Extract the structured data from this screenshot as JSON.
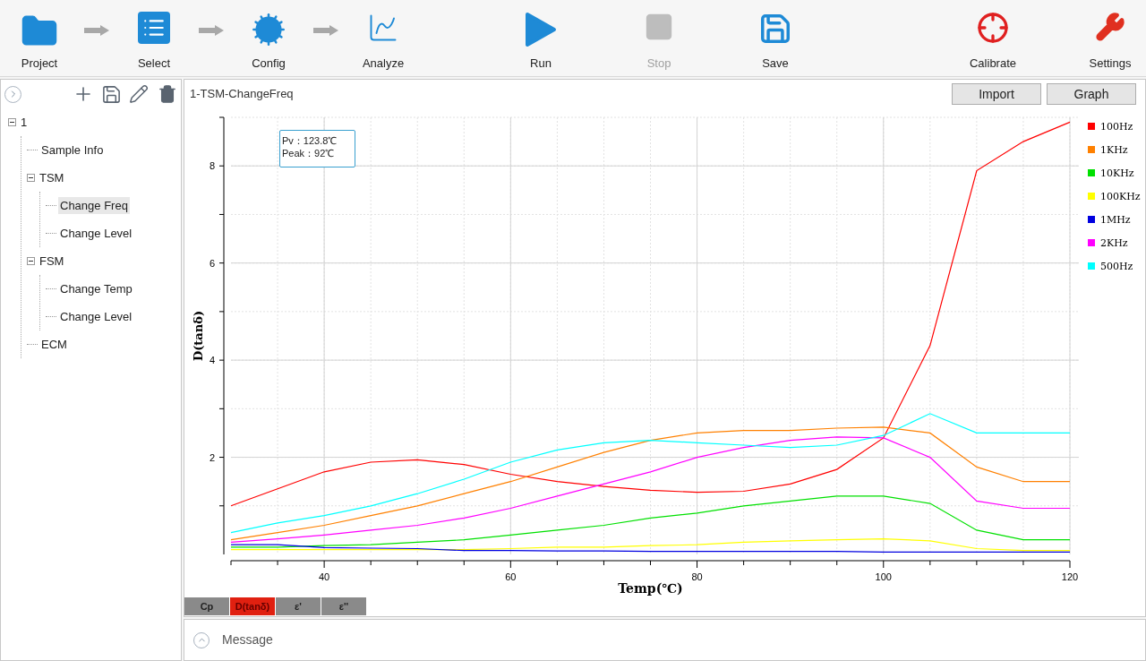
{
  "toolbar": {
    "workflow": [
      {
        "label": "Project"
      },
      {
        "label": "Select"
      },
      {
        "label": "Config"
      },
      {
        "label": "Analyze"
      }
    ],
    "actions": [
      {
        "label": "Run",
        "disabled": false
      },
      {
        "label": "Stop",
        "disabled": true
      },
      {
        "label": "Save",
        "disabled": false
      },
      {
        "label": "Calibrate",
        "disabled": false
      },
      {
        "label": "Settings",
        "disabled": false
      }
    ]
  },
  "sidebar": {
    "tree": [
      {
        "label": "1",
        "expanded": true,
        "selected": false,
        "children": [
          {
            "label": "Sample Info",
            "selected": false
          },
          {
            "label": "TSM",
            "expanded": true,
            "selected": false,
            "children": [
              {
                "label": "Change Freq",
                "selected": true
              },
              {
                "label": "Change Level",
                "selected": false
              }
            ]
          },
          {
            "label": "FSM",
            "expanded": true,
            "selected": false,
            "children": [
              {
                "label": "Change Temp",
                "selected": false
              },
              {
                "label": "Change Level",
                "selected": false
              }
            ]
          },
          {
            "label": "ECM",
            "selected": false
          }
        ]
      }
    ]
  },
  "panel": {
    "title": "1-TSM-ChangeFreq",
    "buttons": [
      "Import",
      "Graph"
    ],
    "readout": [
      "Pv：123.8℃",
      "Peak：92℃"
    ],
    "chart_data": {
      "type": "line",
      "grid": true,
      "legend": true,
      "xlabel": "Temp(℃)",
      "ylabel": "D(tanδ)",
      "x": [
        30,
        35,
        40,
        45,
        50,
        55,
        60,
        65,
        70,
        75,
        80,
        85,
        90,
        95,
        100,
        105,
        110,
        115,
        120
      ],
      "xlim": [
        30,
        120
      ],
      "ylim": [
        0,
        9
      ],
      "xticks": [
        40,
        60,
        80,
        100,
        120
      ],
      "yticks": [
        2,
        4,
        6,
        8
      ],
      "series": [
        {
          "name": "100Hz",
          "color": "#ff0000",
          "values": [
            1.0,
            1.35,
            1.7,
            1.9,
            1.95,
            1.85,
            1.65,
            1.5,
            1.4,
            1.32,
            1.28,
            1.3,
            1.45,
            1.75,
            2.4,
            4.3,
            7.9,
            8.5,
            8.9
          ]
        },
        {
          "name": "1KHz",
          "color": "#ff8000",
          "values": [
            0.3,
            0.45,
            0.6,
            0.8,
            1.0,
            1.25,
            1.5,
            1.8,
            2.1,
            2.35,
            2.5,
            2.55,
            2.55,
            2.6,
            2.62,
            2.5,
            1.8,
            1.5,
            1.5
          ]
        },
        {
          "name": "10KHz",
          "color": "#00e000",
          "values": [
            0.15,
            0.15,
            0.18,
            0.2,
            0.25,
            0.3,
            0.4,
            0.5,
            0.6,
            0.75,
            0.85,
            1.0,
            1.1,
            1.2,
            1.2,
            1.05,
            0.5,
            0.3,
            0.3
          ]
        },
        {
          "name": "100KHz",
          "color": "#ffff00",
          "values": [
            0.1,
            0.1,
            0.1,
            0.1,
            0.1,
            0.1,
            0.12,
            0.15,
            0.15,
            0.18,
            0.2,
            0.25,
            0.28,
            0.3,
            0.32,
            0.28,
            0.12,
            0.08,
            0.08
          ]
        },
        {
          "name": "1MHz",
          "color": "#0000e0",
          "values": [
            0.2,
            0.2,
            0.14,
            0.13,
            0.12,
            0.08,
            0.08,
            0.07,
            0.07,
            0.06,
            0.06,
            0.06,
            0.06,
            0.06,
            0.05,
            0.05,
            0.05,
            0.05,
            0.05
          ]
        },
        {
          "name": "2KHz",
          "color": "#ff00ff",
          "values": [
            0.25,
            0.32,
            0.4,
            0.5,
            0.6,
            0.75,
            0.95,
            1.2,
            1.45,
            1.7,
            2.0,
            2.2,
            2.35,
            2.42,
            2.4,
            2.0,
            1.1,
            0.95,
            0.95
          ]
        },
        {
          "name": "500Hz",
          "color": "#00ffff",
          "values": [
            0.45,
            0.65,
            0.8,
            1.0,
            1.25,
            1.55,
            1.9,
            2.15,
            2.3,
            2.35,
            2.3,
            2.25,
            2.2,
            2.25,
            2.45,
            2.9,
            2.5,
            2.5,
            2.5
          ]
        }
      ]
    },
    "chart_tabs": [
      {
        "label": "Cp",
        "selected": false
      },
      {
        "label": "D(tanδ)",
        "selected": true
      },
      {
        "label": "ε'",
        "selected": false
      },
      {
        "label": "ε''",
        "selected": false
      }
    ]
  },
  "message_bar": {
    "label": "Message",
    "expanded": false
  }
}
